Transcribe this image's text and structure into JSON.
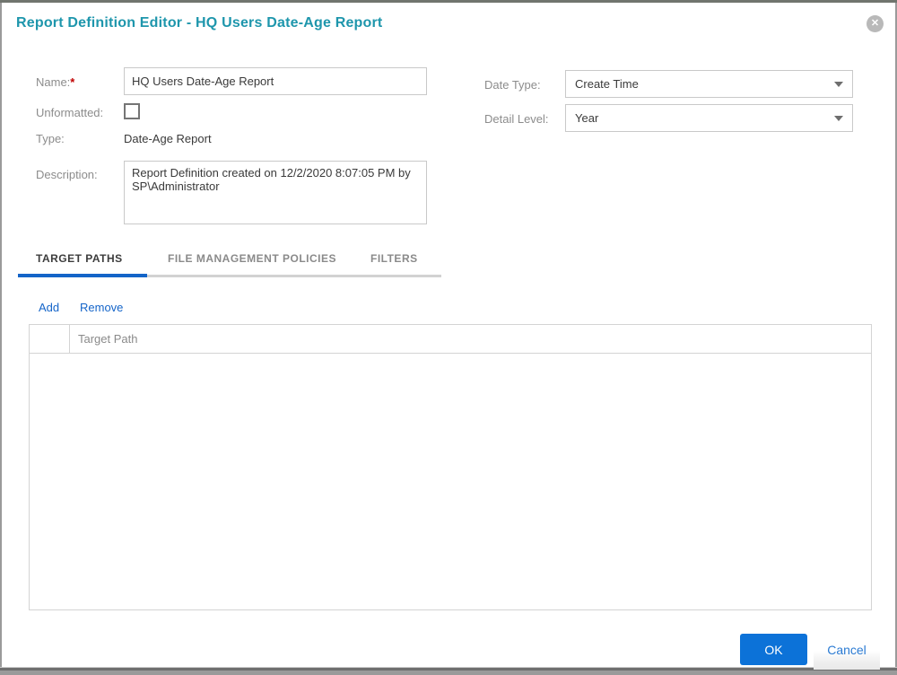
{
  "dialog": {
    "title": "Report Definition Editor - HQ Users Date-Age Report"
  },
  "icons": {
    "close": "✕"
  },
  "form": {
    "name": {
      "label": "Name:",
      "required_marker": "*",
      "value": "HQ Users Date-Age Report"
    },
    "unformatted": {
      "label": "Unformatted:",
      "checked": false
    },
    "type": {
      "label": "Type:",
      "value": "Date-Age Report"
    },
    "description": {
      "label": "Description:",
      "value": "Report Definition created on 12/2/2020 8:07:05 PM by SP\\Administrator"
    },
    "date_type": {
      "label": "Date Type:",
      "value": "Create Time"
    },
    "detail_level": {
      "label": "Detail Level:",
      "value": "Year"
    }
  },
  "tabs": [
    {
      "label": "TARGET PATHS",
      "active": true
    },
    {
      "label": "FILE MANAGEMENT POLICIES",
      "active": false
    },
    {
      "label": "FILTERS",
      "active": false
    }
  ],
  "toolbar": {
    "add_label": "Add",
    "remove_label": "Remove"
  },
  "table": {
    "path_column_header": "Target Path",
    "rows": []
  },
  "footer": {
    "ok_label": "OK",
    "cancel_label": "Cancel"
  },
  "colors": {
    "title_teal": "#1e96ac",
    "accent_blue": "#1464c8",
    "ok_button_blue": "#0c72d8",
    "link_blue": "#1565c9",
    "required_red": "#c00000",
    "label_gray": "#8c8c8c"
  }
}
